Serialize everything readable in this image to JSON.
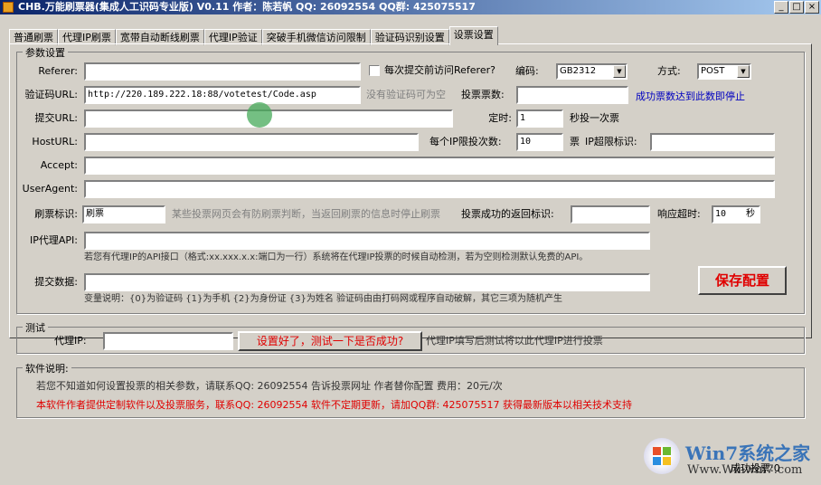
{
  "window": {
    "title": "CHB.万能刷票器(集成人工识码专业版) V0.11 作者：陈若帆 QQ: 26092554 QQ群: 425075517",
    "min": "_",
    "max": "□",
    "close": "×"
  },
  "tabs": [
    "普通刷票",
    "代理IP刷票",
    "宽带自动断线刷票",
    "代理IP验证",
    "突破手机微信访问限制",
    "验证码识别设置",
    "设票设置"
  ],
  "params": {
    "group": "参数设置",
    "referer_label": "Referer:",
    "referer_value": "",
    "visit_referer_label": "每次提交前访问Referer?",
    "encoding_label": "编码:",
    "encoding_value": "GB2312",
    "method_label": "方式:",
    "method_value": "POST",
    "captcha_label": "验证码URL:",
    "captcha_value": "http://220.189.222.18:88/votetest/Code.asp",
    "captcha_hint": "没有验证码可为空",
    "votes_label": "投票票数:",
    "votes_value": "",
    "votes_hint": "成功票数达到此数即停止",
    "submit_label": "提交URL:",
    "submit_value": "",
    "timer_label": "定时:",
    "timer_value": "1",
    "timer_unit": "秒投一次票",
    "host_label": "HostURL:",
    "host_value": "",
    "per_ip_label": "每个IP限投次数:",
    "per_ip_value": "10",
    "per_ip_unit": "票",
    "ip_limit_label": "IP超限标识:",
    "ip_limit_value": "",
    "accept_label": "Accept:",
    "accept_value": "",
    "ua_label": "UserAgent:",
    "ua_value": "",
    "brush_label": "刷票标识:",
    "brush_value": "刷票",
    "brush_hint": "某些投票网页会有防刷票判断，当返回刷票的信息时停止刷票",
    "success_label": "投票成功的返回标识:",
    "success_value": "",
    "timeout_label": "响应超时:",
    "timeout_value": "10",
    "timeout_unit": "秒",
    "api_label": "IP代理API:",
    "api_value": "",
    "api_hint": "若您有代理IP的API接口（格式:xx.xxx.x.x:端口为一行）系统将在代理IP投票的时候自动检测，若为空则检测默认免费的API。",
    "data_label": "提交数据:",
    "data_value": "",
    "data_hint": "变量说明：{0}为验证码 {1}为手机 {2}为身份证 {3}为姓名 验证码由由打码网或程序自动破解，其它三项为随机产生",
    "save_button": "保存配置"
  },
  "test": {
    "group": "测试",
    "proxy_label": "代理IP:",
    "proxy_value": "",
    "test_button": "设置好了，测试一下是否成功?",
    "hint": "代理IP填写后测试将以此代理IP进行投票"
  },
  "about": {
    "group": "软件说明:",
    "line1": "若您不知道如何设置投票的相关参数，请联系QQ: 26092554 告诉投票网址 作者替你配置 费用：20元/次",
    "line2": "本软件作者提供定制软件以及投票服务，联系QQ: 26092554 软件不定期更新，请加QQ群: 425075517 获得最新版本以相关技术支持"
  },
  "status": {
    "success": "成功投票:0"
  },
  "watermark": {
    "brand": "Win7系统之家",
    "url": "Www.Winwin7.com"
  }
}
